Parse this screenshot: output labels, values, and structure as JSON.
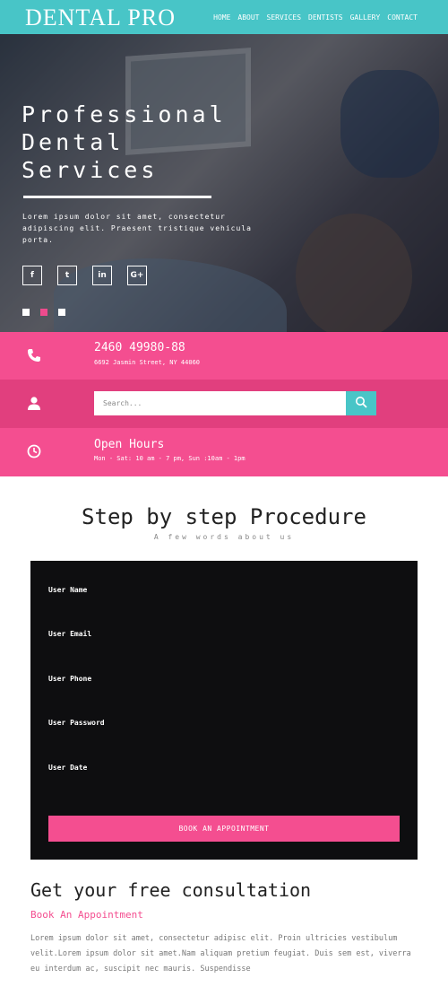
{
  "header": {
    "logo": "DENTAL PRO",
    "nav": [
      "HOME",
      "ABOUT",
      "SERVICES",
      "DENTISTS",
      "GALLERY",
      "CONTACT"
    ]
  },
  "hero": {
    "title": "Professional Dental Services",
    "text": "Lorem ipsum dolor sit amet, consectetur adipiscing elit. Praesent tristique vehicula porta.",
    "socials": [
      {
        "icon": "facebook-icon",
        "glyph": "f"
      },
      {
        "icon": "twitter-icon",
        "glyph": "t"
      },
      {
        "icon": "linkedin-icon",
        "glyph": "in"
      },
      {
        "icon": "google-plus-icon",
        "glyph": "G+"
      }
    ],
    "slides": 3,
    "active_slide": 2
  },
  "info": {
    "phone": "2460 49980-88",
    "address": "6692 Jasmin Street, NY 44060",
    "search_placeholder": "Search...",
    "hours_title": "Open Hours",
    "hours": "Mon - Sat: 10 am - 7 pm, Sun :10am - 1pm"
  },
  "procedure": {
    "title": "Step by step Procedure",
    "subtitle": "A few words about us"
  },
  "form": {
    "fields": [
      "User Name",
      "User Email",
      "User Phone",
      "User Password",
      "User Date"
    ],
    "button": "BOOK AN APPOINTMENT"
  },
  "consultation": {
    "title": "Get your free consultation",
    "link": "Book An Appointment",
    "text": "Lorem ipsum dolor sit amet, consectetur adipisc elit. Proin ultricies vestibulum velit.Lorem ipsum dolor sit amet.Nam aliquam pretium feugiat. Duis sem est, viverra eu interdum ac, suscipit nec mauris. Suspendisse"
  },
  "colors": {
    "teal": "#48c5c7",
    "pink": "#f44e90",
    "dark_pink": "#e13f7e",
    "form_bg": "#0e0e10"
  }
}
